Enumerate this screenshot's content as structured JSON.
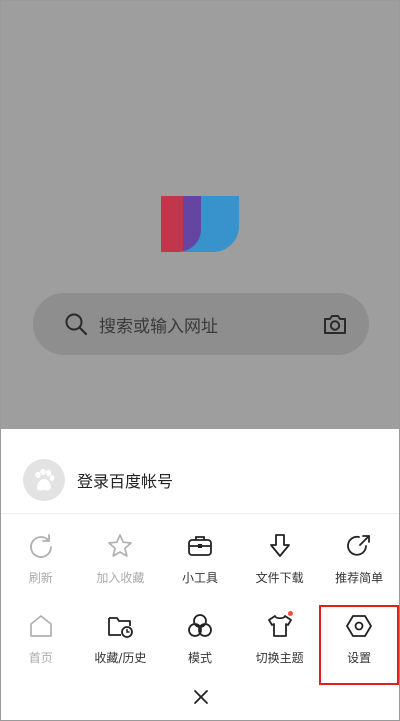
{
  "search": {
    "placeholder": "搜索或输入网址"
  },
  "account": {
    "label": "登录百度帐号"
  },
  "menu": {
    "row1": [
      {
        "label": "刷新",
        "icon": "refresh-icon",
        "enabled": false
      },
      {
        "label": "加入收藏",
        "icon": "star-icon",
        "enabled": false
      },
      {
        "label": "小工具",
        "icon": "toolbox-icon",
        "enabled": true
      },
      {
        "label": "文件下载",
        "icon": "download-icon",
        "enabled": true
      },
      {
        "label": "推荐简单",
        "icon": "share-icon",
        "enabled": true
      }
    ],
    "row2": [
      {
        "label": "首页",
        "icon": "home-icon",
        "enabled": false
      },
      {
        "label": "收藏/历史",
        "icon": "folder-history-icon",
        "enabled": true
      },
      {
        "label": "模式",
        "icon": "mode-circles-icon",
        "enabled": true
      },
      {
        "label": "切换主题",
        "icon": "tshirt-icon",
        "enabled": true,
        "badge": true
      },
      {
        "label": "设置",
        "icon": "settings-hexagon-icon",
        "enabled": true,
        "highlighted": true
      }
    ]
  },
  "colors": {
    "highlight": "#e02020",
    "badge": "#ff4d3a",
    "logo_red": "#c8233c",
    "logo_blue": "#1e8fd6",
    "logo_purple": "#6a3fa0"
  }
}
